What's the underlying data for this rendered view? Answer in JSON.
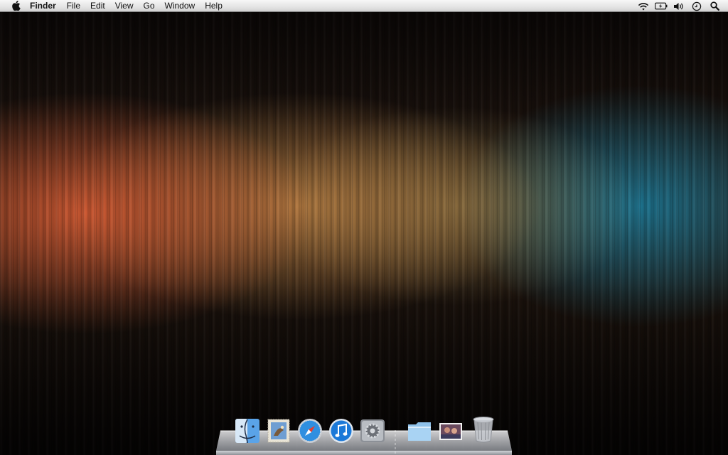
{
  "menubar": {
    "app_menu": "Finder",
    "menus": [
      "File",
      "Edit",
      "View",
      "Go",
      "Window",
      "Help"
    ],
    "status_icons": [
      "wifi-icon",
      "battery-icon",
      "volume-icon",
      "time-machine-icon",
      "spotlight-icon"
    ]
  },
  "dock": {
    "items": [
      "finder-icon",
      "mail-icon",
      "safari-icon",
      "itunes-icon",
      "system-preferences-icon",
      "documents-folder-icon",
      "photos-stack-icon",
      "trash-icon"
    ]
  },
  "colors": {
    "wallpaper_orange": "#d65c34",
    "wallpaper_amber": "#c48848",
    "wallpaper_teal": "#1c7896",
    "menubar_bg": "#e6e6e6",
    "menubar_text": "#111111"
  }
}
